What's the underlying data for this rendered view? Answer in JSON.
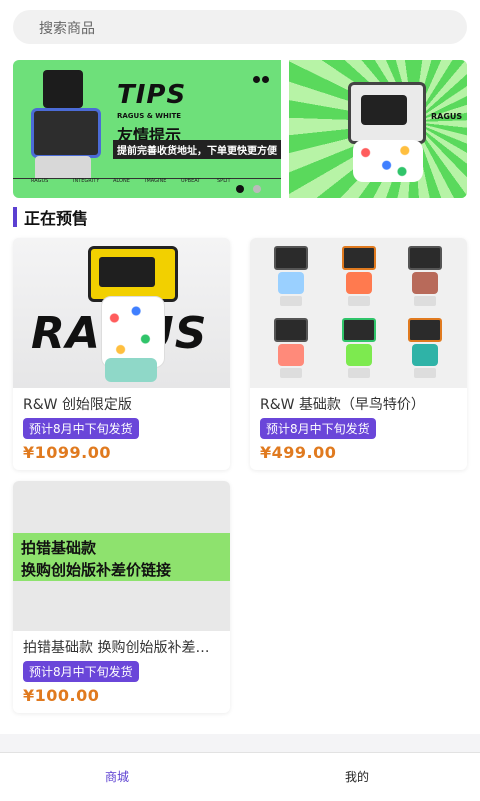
{
  "search": {
    "placeholder": "搜索商品"
  },
  "banner": {
    "title": "TIPS",
    "subtitle": "RAGUS & WHITE",
    "heading": "友情提示",
    "note": "提前完善收货地址，下单更快更方便",
    "footer_tags": [
      "RAGUS",
      "INTEGRITY",
      "ALONE",
      "IMAGINE",
      "UPBEAT",
      "SPLIT"
    ],
    "figure_label": "RAGUS",
    "pagination": {
      "count": 2,
      "active_index": 0
    }
  },
  "section": {
    "title": "正在预售"
  },
  "products": [
    {
      "name": "R&W 创始限定版",
      "badge": "预计8月中下旬发货",
      "price": "¥1099.00",
      "image_text": "RAGUS"
    },
    {
      "name": "R&W 基础款（早鸟特价）",
      "badge": "预计8月中下旬发货",
      "price": "¥499.00"
    },
    {
      "name": "拍错基础款 换购创始版补差价链接",
      "badge": "预计8月中下旬发货",
      "price": "¥100.00",
      "image_lines": [
        "拍错基础款",
        "换购创始版补差价链接"
      ]
    }
  ],
  "tabbar": {
    "items": [
      {
        "label": "商城",
        "active": true
      },
      {
        "label": "我的",
        "active": false
      }
    ]
  },
  "colors": {
    "accent": "#5b3fd1",
    "badge_bg": "#6a46d9",
    "price": "#e07a1f",
    "banner_green": "#6ee07a"
  }
}
